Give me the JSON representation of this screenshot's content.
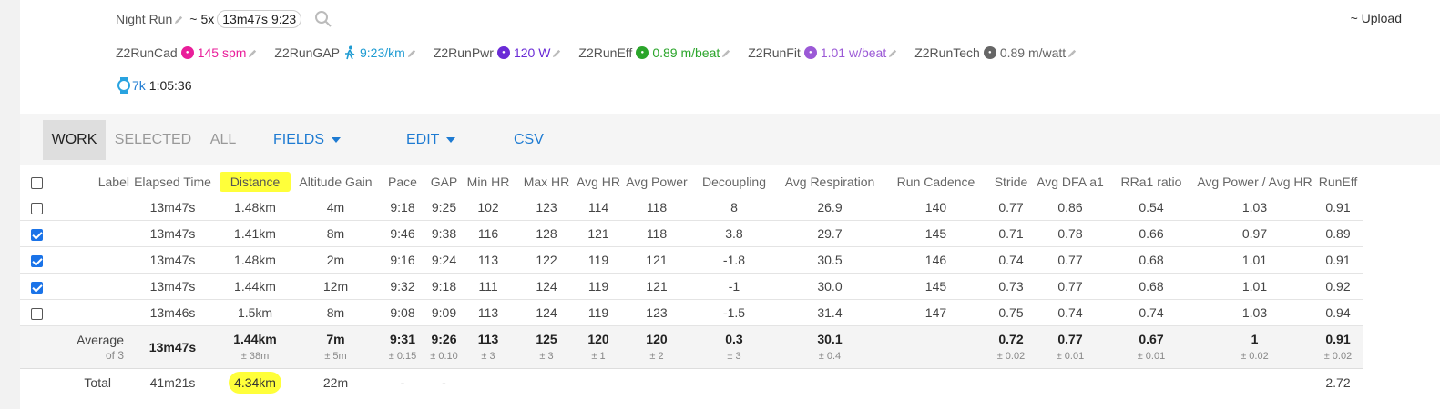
{
  "activity": {
    "title": "Night Run",
    "tilde": "~",
    "reps": "5x",
    "interval_chip": "13m47s 9:23",
    "upload_label": "~ Upload"
  },
  "metrics": [
    {
      "name": "Z2RunCad",
      "value": "145 spm",
      "color": "#e91e9a",
      "icon": "run-cadence-icon"
    },
    {
      "name": "Z2RunGAP",
      "value": "9:23/km",
      "color": "#1e9bd2",
      "icon": "runner-icon"
    },
    {
      "name": "Z2RunPwr",
      "value": "120 W",
      "color": "#6a2bd6",
      "icon": "power-icon"
    },
    {
      "name": "Z2RunEff",
      "value": "0.89 m/beat",
      "color": "#2ba52b",
      "icon": "efficiency-icon"
    },
    {
      "name": "Z2RunFit",
      "value": "1.01 w/beat",
      "color": "#9b59d6",
      "icon": "fitness-icon"
    },
    {
      "name": "Z2RunTech",
      "value": "0.89 m/watt",
      "color": "#666666",
      "icon": "technique-icon"
    }
  ],
  "summary": {
    "distance": "7k",
    "duration": "1:05:36"
  },
  "toolbar": {
    "tab_work": "WORK",
    "tab_selected": "SELECTED",
    "tab_all": "ALL",
    "fields": "FIELDS",
    "edit": "EDIT",
    "csv": "CSV"
  },
  "table": {
    "headers": [
      "Label",
      "Elapsed Time",
      "Distance",
      "Altitude Gain",
      "Pace",
      "GAP",
      "Min HR",
      "Max HR",
      "Avg HR",
      "Avg Power",
      "Decoupling",
      "Avg Respiration",
      "Run Cadence",
      "Stride",
      "Avg DFA a1",
      "RRa1 ratio",
      "Avg Power / Avg HR",
      "RunEff"
    ],
    "rows": [
      {
        "checked": false,
        "cells": [
          "",
          "13m47s",
          "1.48km",
          "4m",
          "9:18",
          "9:25",
          "102",
          "123",
          "114",
          "118",
          "8",
          "26.9",
          "140",
          "0.77",
          "0.86",
          "0.54",
          "1.03",
          "0.91"
        ]
      },
      {
        "checked": true,
        "cells": [
          "",
          "13m47s",
          "1.41km",
          "8m",
          "9:46",
          "9:38",
          "116",
          "128",
          "121",
          "118",
          "3.8",
          "29.7",
          "145",
          "0.71",
          "0.78",
          "0.66",
          "0.97",
          "0.89"
        ]
      },
      {
        "checked": true,
        "cells": [
          "",
          "13m47s",
          "1.48km",
          "2m",
          "9:16",
          "9:24",
          "113",
          "122",
          "119",
          "121",
          "-1.8",
          "30.5",
          "146",
          "0.74",
          "0.77",
          "0.68",
          "1.01",
          "0.91"
        ]
      },
      {
        "checked": true,
        "cells": [
          "",
          "13m47s",
          "1.44km",
          "12m",
          "9:32",
          "9:18",
          "111",
          "124",
          "119",
          "121",
          "-1",
          "30.0",
          "145",
          "0.73",
          "0.77",
          "0.68",
          "1.01",
          "0.92"
        ]
      },
      {
        "checked": false,
        "cells": [
          "",
          "13m46s",
          "1.5km",
          "8m",
          "9:08",
          "9:09",
          "113",
          "124",
          "119",
          "123",
          "-1.5",
          "31.4",
          "147",
          "0.75",
          "0.74",
          "0.74",
          "1.03",
          "0.94"
        ]
      }
    ],
    "average": {
      "label": "Average",
      "of": "of 3",
      "cells": [
        {
          "main": "13m47s",
          "sub": ""
        },
        {
          "main": "1.44km",
          "sub": "± 38m"
        },
        {
          "main": "7m",
          "sub": "± 5m"
        },
        {
          "main": "9:31",
          "sub": "± 0:15"
        },
        {
          "main": "9:26",
          "sub": "± 0:10"
        },
        {
          "main": "113",
          "sub": "± 3"
        },
        {
          "main": "125",
          "sub": "± 3"
        },
        {
          "main": "120",
          "sub": "± 1"
        },
        {
          "main": "120",
          "sub": "± 2"
        },
        {
          "main": "0.3",
          "sub": "± 3"
        },
        {
          "main": "30.1",
          "sub": "± 0.4"
        },
        {
          "main": "",
          "sub": ""
        },
        {
          "main": "0.72",
          "sub": "± 0.02"
        },
        {
          "main": "0.77",
          "sub": "± 0.01"
        },
        {
          "main": "0.67",
          "sub": "± 0.01"
        },
        {
          "main": "1",
          "sub": "± 0.02"
        },
        {
          "main": "0.91",
          "sub": "± 0.02"
        }
      ]
    },
    "total": {
      "label": "Total",
      "cells": [
        "41m21s",
        "4.34km",
        "22m",
        "-",
        "-",
        "",
        "",
        "",
        "",
        "",
        "",
        "",
        "",
        "",
        "",
        "",
        "2.72"
      ]
    }
  }
}
